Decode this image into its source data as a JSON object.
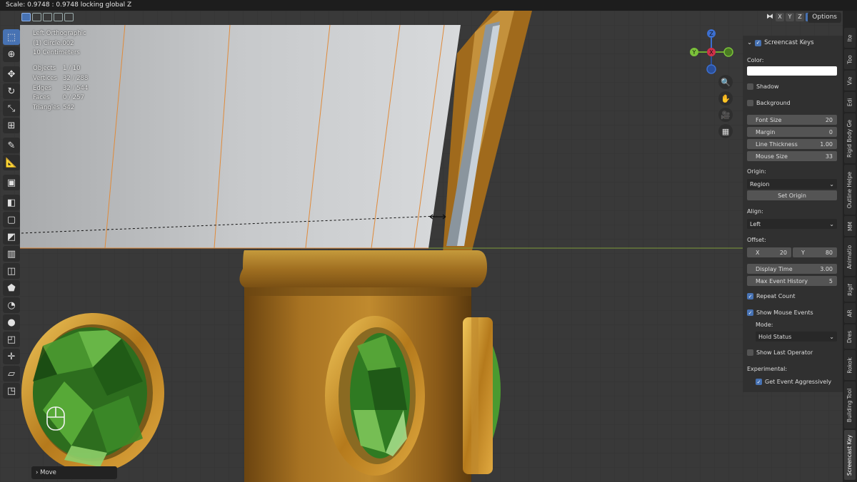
{
  "status_bar": {
    "text": "Scale: 0.9748 : 0.9748 locking global Z"
  },
  "header": {
    "axis_buttons": [
      "X",
      "Y",
      "Z"
    ],
    "options_label": "Options"
  },
  "overlay": {
    "view_name": "Left Orthographic",
    "object_name": "(1) Circle.002",
    "scale_text": "10 Centimeters",
    "stats": [
      {
        "key": "Objects",
        "value": "1 / 10"
      },
      {
        "key": "Vertices",
        "value": "32 / 288"
      },
      {
        "key": "Edges",
        "value": "32 / 544"
      },
      {
        "key": "Faces",
        "value": "0 / 257"
      },
      {
        "key": "Triangles",
        "value": "542"
      }
    ]
  },
  "last_operator": {
    "label": "Move"
  },
  "sidebar": {
    "panel_title": "Screencast Keys",
    "color_label": "Color:",
    "shadow_label": "Shadow",
    "background_label": "Background",
    "font_size": {
      "label": "Font Size",
      "value": "20"
    },
    "margin": {
      "label": "Margin",
      "value": "0"
    },
    "line_thickness": {
      "label": "Line Thickness",
      "value": "1.00"
    },
    "mouse_size": {
      "label": "Mouse Size",
      "value": "33"
    },
    "origin_label": "Origin:",
    "origin_value": "Region",
    "set_origin_label": "Set Origin",
    "align_label": "Align:",
    "align_value": "Left",
    "offset_label": "Offset:",
    "offset_x": {
      "label": "X",
      "value": "20"
    },
    "offset_y": {
      "label": "Y",
      "value": "80"
    },
    "display_time": {
      "label": "Display Time",
      "value": "3.00"
    },
    "max_event_history": {
      "label": "Max Event History",
      "value": "5"
    },
    "repeat_count_label": "Repeat Count",
    "show_mouse_events_label": "Show Mouse Events",
    "mode_label": "Mode:",
    "mode_value": "Hold Status",
    "show_last_operator_label": "Show Last Operator",
    "experimental_label": "Experimental:",
    "get_event_aggressively_label": "Get Event Aggressively",
    "colors": {
      "panel_bg": "#303030",
      "field": "#545454",
      "accent": "#4772b3"
    }
  },
  "tabs": [
    "Ite",
    "Too",
    "Vie",
    "Edi",
    "Rigid Body Ge",
    "Outline Helpe",
    "MM",
    "Animatio",
    "Rigif",
    "AR",
    "Dres",
    "Rokok",
    "Building Tool",
    "Screencast Key"
  ],
  "gizmo": {
    "axes": [
      "Z",
      "Y",
      "X"
    ]
  },
  "colors": {
    "viewport_bg": "#393939",
    "gold": "#b8862a",
    "emerald": "#3e8a2a",
    "selected_edge": "#e08a3a"
  }
}
